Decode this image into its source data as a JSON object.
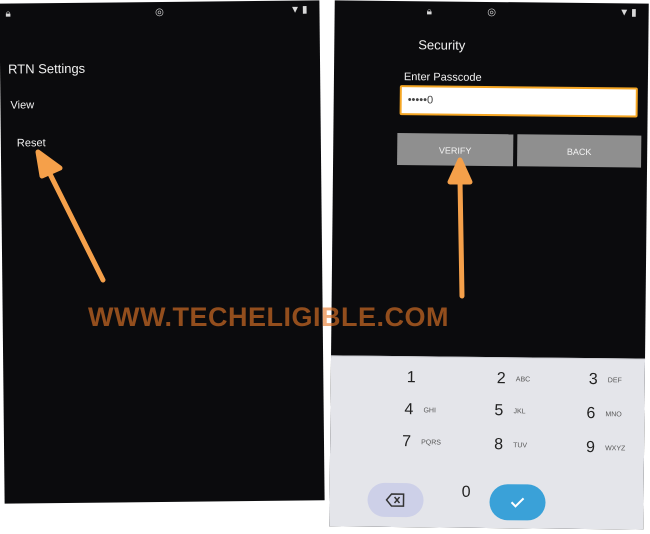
{
  "left_screen": {
    "title": "RTN Settings",
    "items": [
      {
        "label": "View"
      },
      {
        "label": "Reset"
      }
    ]
  },
  "right_screen": {
    "title": "Security",
    "passcode_label": "Enter Passcode",
    "passcode_value": "•••••0",
    "verify_label": "VERIFY",
    "back_label": "BACK"
  },
  "keypad": {
    "keys": [
      {
        "num": "1",
        "letters": ""
      },
      {
        "num": "2",
        "letters": "ABC"
      },
      {
        "num": "3",
        "letters": "DEF"
      },
      {
        "num": "4",
        "letters": "GHI"
      },
      {
        "num": "5",
        "letters": "JKL"
      },
      {
        "num": "6",
        "letters": "MNO"
      },
      {
        "num": "7",
        "letters": "PQRS"
      },
      {
        "num": "8",
        "letters": "TUV"
      },
      {
        "num": "9",
        "letters": "WXYZ"
      },
      {
        "num": "0",
        "letters": ""
      }
    ],
    "delete_icon": "backspace-icon",
    "done_icon": "check-icon"
  },
  "watermark": "WWW.TECHELIGIBLE.COM",
  "colors": {
    "accent_arrow": "#f5a04a",
    "input_border": "#f5a623",
    "done_key": "#3aa1d8",
    "button_bg": "#8f8f8f"
  }
}
